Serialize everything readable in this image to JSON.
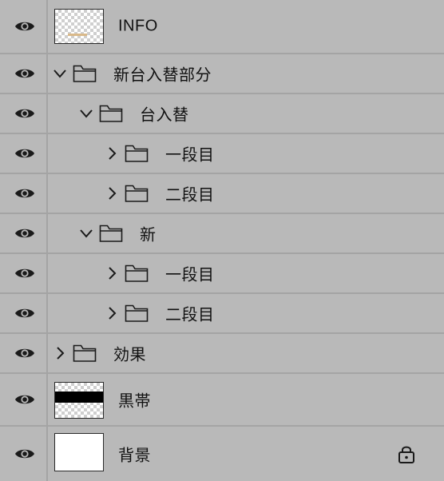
{
  "layers_panel": {
    "layers": [
      {
        "name": "INFO",
        "kind": "text-layer",
        "visible": true
      },
      {
        "name": "新台入替部分",
        "kind": "group",
        "expanded": true,
        "visible": true
      },
      {
        "name": "台入替",
        "kind": "group",
        "expanded": true,
        "visible": true
      },
      {
        "name": "一段目",
        "kind": "group",
        "expanded": false,
        "visible": true
      },
      {
        "name": "二段目",
        "kind": "group",
        "expanded": false,
        "visible": true
      },
      {
        "name": "新",
        "kind": "group",
        "expanded": true,
        "visible": true
      },
      {
        "name": "一段目",
        "kind": "group",
        "expanded": false,
        "visible": true
      },
      {
        "name": "二段目",
        "kind": "group",
        "expanded": false,
        "visible": true
      },
      {
        "name": "効果",
        "kind": "group",
        "expanded": false,
        "visible": true
      },
      {
        "name": "黒帯",
        "kind": "pixel-layer",
        "visible": true
      },
      {
        "name": "背景",
        "kind": "background",
        "visible": true,
        "locked": true
      }
    ]
  },
  "icons": {
    "visibility": "eye-icon",
    "group": "folder-icon",
    "expanded": "chevron-down-icon",
    "collapsed": "chevron-right-icon",
    "locked": "lock-icon"
  },
  "colors": {
    "panel_bg": "#b9b9b9",
    "divider": "#a4a4a4",
    "icon": "#1a1a1a"
  }
}
